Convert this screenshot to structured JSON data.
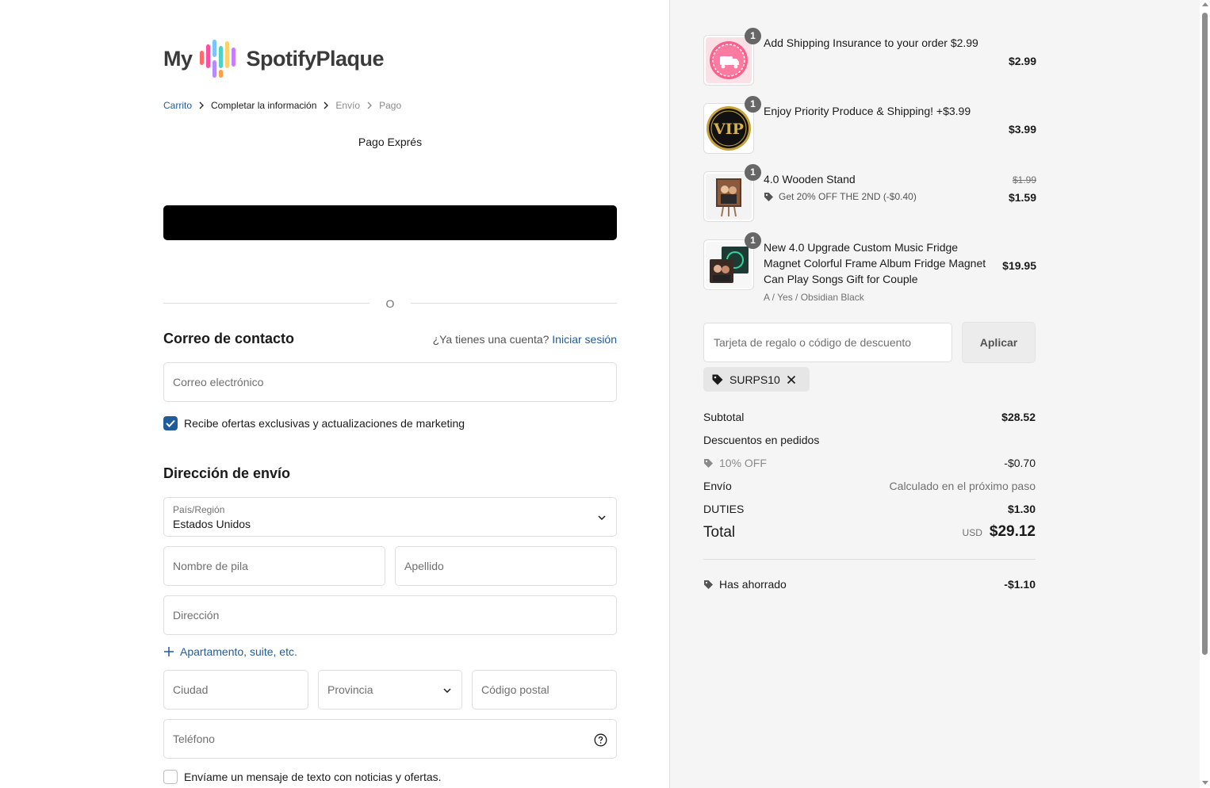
{
  "brand": {
    "logo_prefix": "My",
    "logo_name": "SpotifyPlaque"
  },
  "breadcrumb": {
    "cart": "Carrito",
    "info": "Completar la información",
    "shipping": "Envío",
    "payment": "Pago"
  },
  "express": {
    "title": "Pago Exprés"
  },
  "divider": {
    "or": "O"
  },
  "contact": {
    "heading": "Correo de contacto",
    "account_prompt": "¿Ya tienes una cuenta?",
    "login_link": "Iniciar sesión",
    "email_placeholder": "Correo electrónico",
    "marketing_label": "Recibe ofertas exclusivas y actualizaciones de marketing",
    "marketing_checked": true
  },
  "shipping": {
    "heading": "Dirección de envío",
    "country_label": "País/Región",
    "country_value": "Estados Unidos",
    "first_name_placeholder": "Nombre de pila",
    "last_name_placeholder": "Apellido",
    "address_placeholder": "Dirección",
    "apartment_link": "Apartamento, suite, etc.",
    "city_placeholder": "Ciudad",
    "province_placeholder": "Provincia",
    "postal_placeholder": "Código postal",
    "phone_placeholder": "Teléfono",
    "sms_label": "Envíame un mensaje de texto con noticias y ofertas.",
    "sms_checked": false
  },
  "order": {
    "items": [
      {
        "qty": "1",
        "name": "Add Shipping Insurance to your order $2.99",
        "price": "$2.99"
      },
      {
        "qty": "1",
        "name": "Enjoy Priority Produce & Shipping! +$3.99",
        "price": "$3.99",
        "badge_text": "VIP"
      },
      {
        "qty": "1",
        "name": "4.0 Wooden Stand",
        "compare_price": "$1.99",
        "discount": "Get 20% OFF THE 2ND (-$0.40)",
        "price": "$1.59"
      },
      {
        "qty": "1",
        "name_lines": [
          "New 4.0 Upgrade Custom Music Fridge",
          "Magnet Colorful Frame Album Fridge Magnet",
          "Can Play Songs Gift for Couple"
        ],
        "variant": "A / Yes / Obsidian Black",
        "price": "$19.95"
      }
    ],
    "gift_placeholder": "Tarjeta de regalo o código de descuento",
    "apply_label": "Aplicar",
    "applied_code": "SURPS10",
    "subtotal_label": "Subtotal",
    "subtotal": "$28.52",
    "order_discounts_label": "Descuentos en pedidos",
    "discount_name": "10% OFF",
    "discount_value": "-$0.70",
    "shipping_label": "Envío",
    "shipping_value": "Calculado en el próximo paso",
    "duties_label": "DUTIES",
    "duties_value": "$1.30",
    "total_label": "Total",
    "currency": "USD",
    "total": "$29.12",
    "saved_label": "Has ahorrado",
    "saved_value": "-$1.10"
  },
  "colors": {
    "link": "#1f5c99",
    "checkbox": "#1f5c99",
    "express_button": "#000000",
    "panel_bg": "#f5f5f5"
  }
}
